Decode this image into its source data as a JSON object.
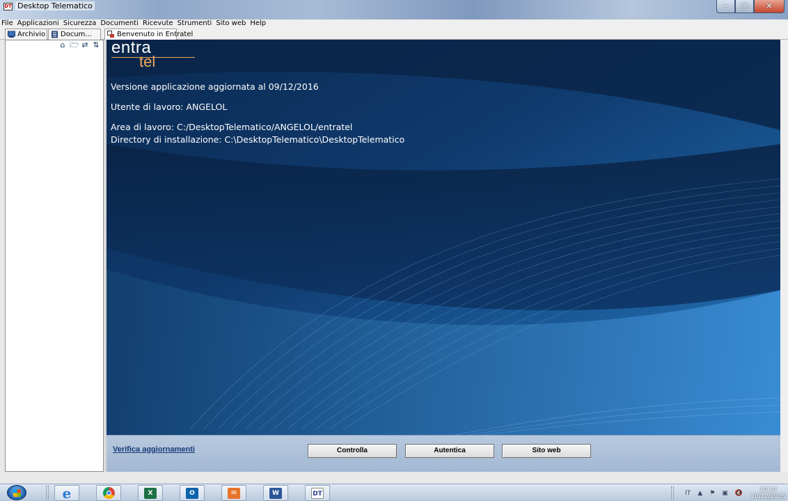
{
  "window": {
    "title": "Desktop Telematico",
    "app_icon_label": "DT",
    "controls": [
      "minimize",
      "maximize",
      "close"
    ]
  },
  "menu": [
    "File",
    "Applicazioni",
    "Sicurezza",
    "Documenti",
    "Ricevute",
    "Strumenti",
    "Sito web",
    "Help"
  ],
  "tabs": {
    "archivio": "Archivio",
    "documenti": "Docum...",
    "main": "Benvenuto in Entratel"
  },
  "left_toolbar_icons": [
    "home-icon",
    "folder-icon",
    "refresh-icon",
    "sort-icon"
  ],
  "welcome": {
    "logo_top": "entra",
    "logo_bottom": "tel",
    "version_line": "Versione applicazione aggiornata al 09/12/2016",
    "user_line": "Utente di lavoro: ANGELOL",
    "workarea_line": "Area di lavoro: C:/DesktopTelematico/ANGELOL/entratel",
    "installdir_line": "Directory di installazione: C:\\DesktopTelematico\\DesktopTelematico"
  },
  "bottom": {
    "update_link": "Verifica aggiornamenti",
    "buttons": [
      "Controlla",
      "Autentica",
      "Sito web"
    ]
  },
  "taskbar": {
    "apps": [
      "internet-explorer",
      "chrome",
      "excel",
      "outlook",
      "mail",
      "word",
      "desktop-telematico"
    ],
    "app_labels": {
      "excel": "X",
      "outlook": "O",
      "word": "W",
      "dt": "DT"
    },
    "tray": {
      "language": "IT",
      "time": "10:14",
      "date": "10/12/2016"
    }
  },
  "colors": {
    "panel_dark": "#0a2448",
    "panel_blue": "#1d63a6",
    "logo_orange": "#f0a95a",
    "link": "#1a3a78"
  }
}
